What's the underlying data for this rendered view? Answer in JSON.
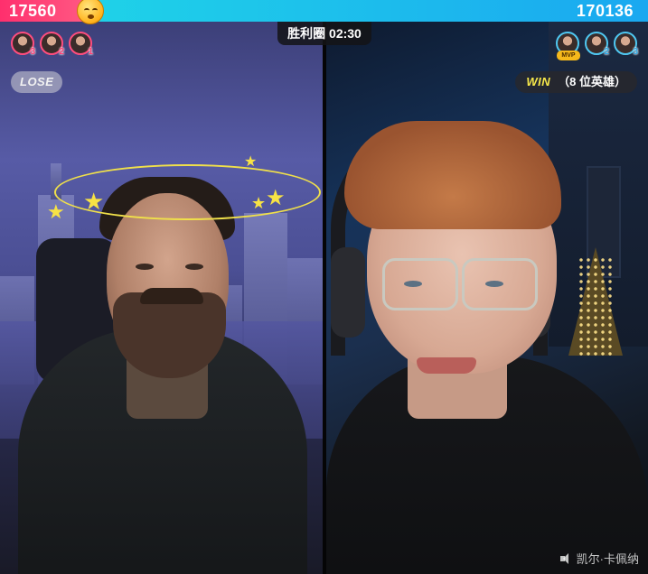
{
  "scorebar": {
    "left_score": "17560",
    "right_score": "170136",
    "left_color": "#ff2f6d",
    "right_color": "#1fd2e8",
    "divider_icon": "dizzy-face-emoji-icon"
  },
  "timer": {
    "label": "胜利圈",
    "time": "02:30",
    "text": "胜利圈 02:30"
  },
  "left_team": {
    "result": "LOSE",
    "supporters": [
      {
        "rank": "3",
        "icon": "supporter-avatar-icon"
      },
      {
        "rank": "2",
        "icon": "supporter-avatar-icon"
      },
      {
        "rank": "1",
        "icon": "supporter-avatar-icon"
      }
    ],
    "accent": "#ff4d7e"
  },
  "right_team": {
    "result_word": "WIN",
    "result_detail": "（8 位英雄）",
    "mvp_label": "MVP",
    "supporters": [
      {
        "rank": "",
        "icon": "supporter-avatar-icon",
        "mvp": true
      },
      {
        "rank": "2",
        "icon": "supporter-avatar-icon"
      },
      {
        "rank": "3",
        "icon": "supporter-avatar-icon"
      }
    ],
    "accent": "#4fc8f2"
  },
  "watermark": {
    "icon": "speaker-muted-icon",
    "text": "凯尔·卡佩纳"
  }
}
